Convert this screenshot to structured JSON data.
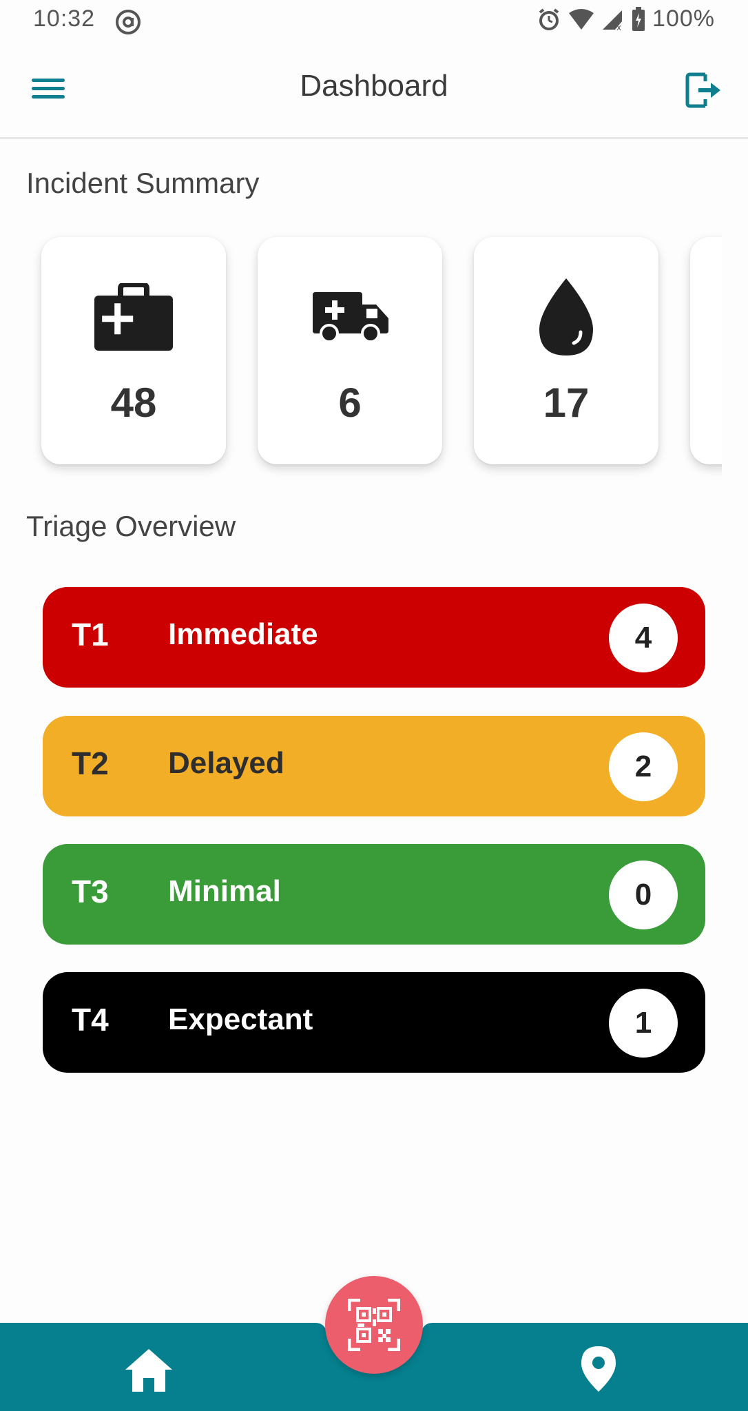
{
  "status_bar": {
    "time": "10:32",
    "battery": "100%"
  },
  "header": {
    "title": "Dashboard"
  },
  "incident_summary": {
    "title": "Incident Summary",
    "cards": [
      {
        "icon": "medical-kit-icon",
        "value": "48"
      },
      {
        "icon": "ambulance-icon",
        "value": "6"
      },
      {
        "icon": "blood-drop-icon",
        "value": "17"
      }
    ]
  },
  "triage_overview": {
    "title": "Triage Overview",
    "rows": [
      {
        "code": "T1",
        "label": "Immediate",
        "count": "4",
        "color": "#cc0000",
        "text_color": "#ffffff"
      },
      {
        "code": "T2",
        "label": "Delayed",
        "count": "2",
        "color": "#f1ae26",
        "text_color": "#2e2e2e"
      },
      {
        "code": "T3",
        "label": "Minimal",
        "count": "0",
        "color": "#3a9c38",
        "text_color": "#ffffff"
      },
      {
        "code": "T4",
        "label": "Expectant",
        "count": "1",
        "color": "#000000",
        "text_color": "#ffffff"
      }
    ]
  },
  "bottom_nav": {
    "home_icon": "home-icon",
    "scan_icon": "qr-scan-icon",
    "location_icon": "location-pin-icon",
    "bar_color": "#06808f",
    "fab_color": "#ec5e6c"
  },
  "theme": {
    "accent": "#0f7f8f"
  }
}
